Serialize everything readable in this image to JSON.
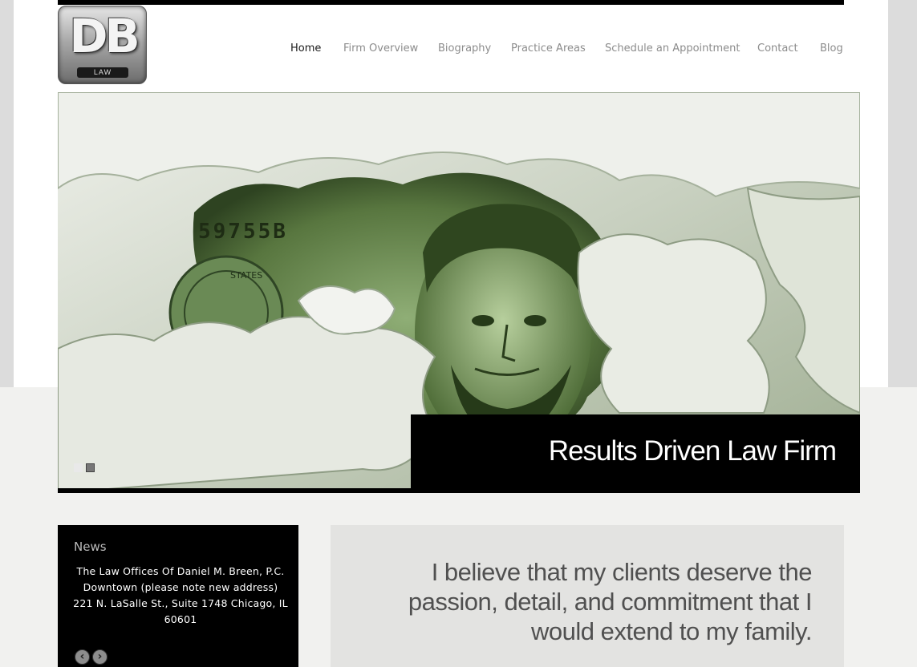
{
  "logo": {
    "mark": "DB",
    "badge": "LAW"
  },
  "nav": {
    "items": [
      {
        "label": "Home",
        "active": true
      },
      {
        "label": "Firm Overview",
        "active": false
      },
      {
        "label": "Biography",
        "active": false
      },
      {
        "label": "Practice Areas",
        "active": false
      },
      {
        "label": "Schedule an Appointment",
        "active": false
      },
      {
        "label": "Contact",
        "active": false
      },
      {
        "label": "Blog",
        "active": false
      }
    ]
  },
  "slider": {
    "caption": "Results Driven Law Firm",
    "banknote_serial": "59755B",
    "seal_text": "STATES",
    "slide_count": 2,
    "active_slide": 2
  },
  "news": {
    "title": "News",
    "body": "The Law Offices Of Daniel M. Breen, P.C. Downtown (please note new address) 221 N. LaSalle St., Suite 1748 Chicago, IL 60601",
    "prev_icon": "chevron-left-icon",
    "next_icon": "chevron-right-icon"
  },
  "quote": {
    "text": "I believe that my clients deserve the passion, detail, and commitment that I would extend to my family."
  },
  "colors": {
    "accent_black": "#000000",
    "nav_active": "#1b1b1b",
    "nav_inactive": "#8c8c8c",
    "quote_bg": "#e3e3e1",
    "slide_green": "#6f8f5a"
  }
}
